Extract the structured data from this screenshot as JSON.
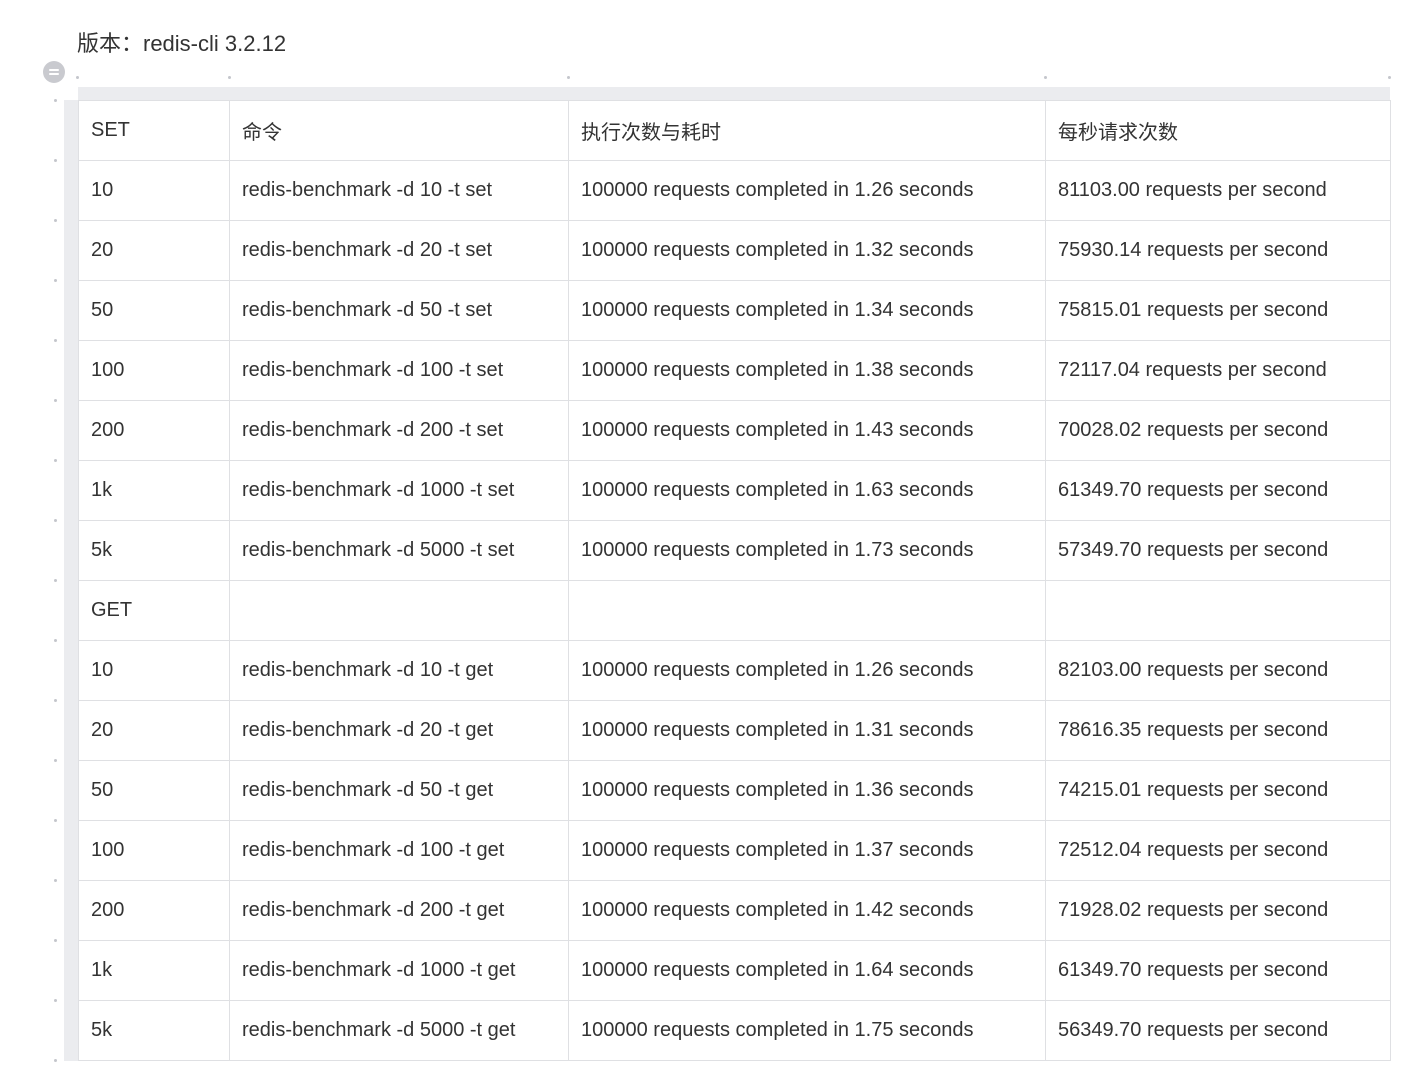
{
  "version_line": "版本：redis-cli 3.2.12",
  "table": {
    "header": [
      "SET",
      "命令",
      "执行次数与耗时",
      "每秒请求次数"
    ],
    "rows": [
      [
        "10",
        "redis-benchmark -d 10 -t set",
        "100000 requests completed in 1.26 seconds",
        "81103.00 requests per second"
      ],
      [
        "20",
        "redis-benchmark -d 20 -t set",
        "100000 requests completed in 1.32 seconds",
        "75930.14 requests per second"
      ],
      [
        "50",
        "redis-benchmark -d 50 -t set",
        "100000 requests completed in 1.34 seconds",
        "75815.01 requests per second"
      ],
      [
        "100",
        "redis-benchmark -d 100 -t set",
        "100000 requests completed in 1.38 seconds",
        "72117.04 requests per second"
      ],
      [
        "200",
        "redis-benchmark -d 200 -t set",
        "100000 requests completed in 1.43 seconds",
        "70028.02 requests per second"
      ],
      [
        "1k",
        "redis-benchmark -d 1000 -t set",
        "100000 requests completed in 1.63 seconds",
        "61349.70 requests per second"
      ],
      [
        "5k",
        "redis-benchmark -d 5000 -t set",
        "100000 requests completed in 1.73 seconds",
        "57349.70 requests per second"
      ],
      [
        "GET",
        "",
        "",
        ""
      ],
      [
        "10",
        "redis-benchmark -d 10 -t get",
        "100000 requests completed in 1.26 seconds",
        "82103.00 requests per second"
      ],
      [
        "20",
        "redis-benchmark -d 20 -t get",
        "100000 requests completed in 1.31 seconds",
        "78616.35 requests per second"
      ],
      [
        "50",
        "redis-benchmark -d 50 -t get",
        "100000 requests completed in 1.36 seconds",
        "74215.01 requests per second"
      ],
      [
        "100",
        "redis-benchmark -d 100 -t get",
        "100000 requests completed in 1.37 seconds",
        "72512.04 requests per second"
      ],
      [
        "200",
        "redis-benchmark -d 200 -t get",
        "100000 requests completed in 1.42 seconds",
        "71928.02 requests per second"
      ],
      [
        "1k",
        "redis-benchmark -d 1000 -t get",
        "100000 requests completed in 1.64 seconds",
        "61349.70 requests per second"
      ],
      [
        "5k",
        "redis-benchmark -d 5000 -t get",
        "100000 requests completed in 1.75 seconds",
        "56349.70 requests per second"
      ]
    ]
  },
  "icons": {
    "table_handle": "table-menu-handle-icon"
  },
  "colors": {
    "text": "#333333",
    "border": "#dfe0e3",
    "rail": "#ebecef",
    "handle": "#c9cacf"
  }
}
